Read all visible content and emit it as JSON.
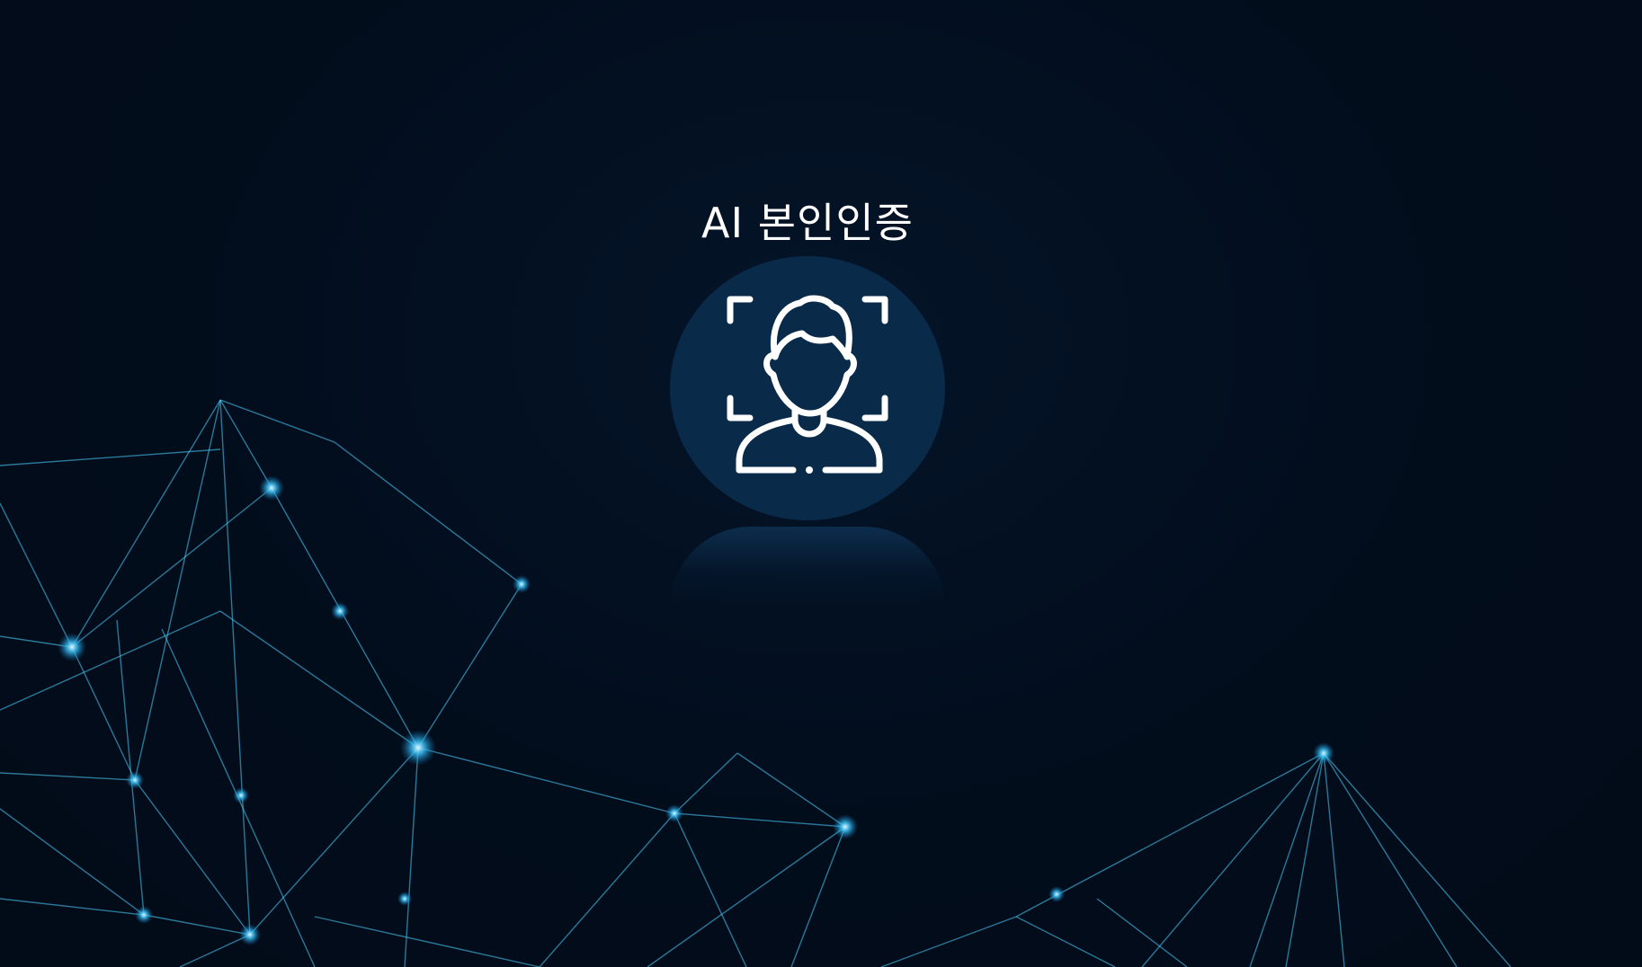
{
  "page": {
    "title": "AI 본인인증"
  },
  "face_scan": {
    "icon": "face-recognition-icon"
  },
  "colors": {
    "background": "#020d1c",
    "circle": "#0a2a4a",
    "network_line": "#4fd2ff",
    "title_text": "#ffffff"
  }
}
